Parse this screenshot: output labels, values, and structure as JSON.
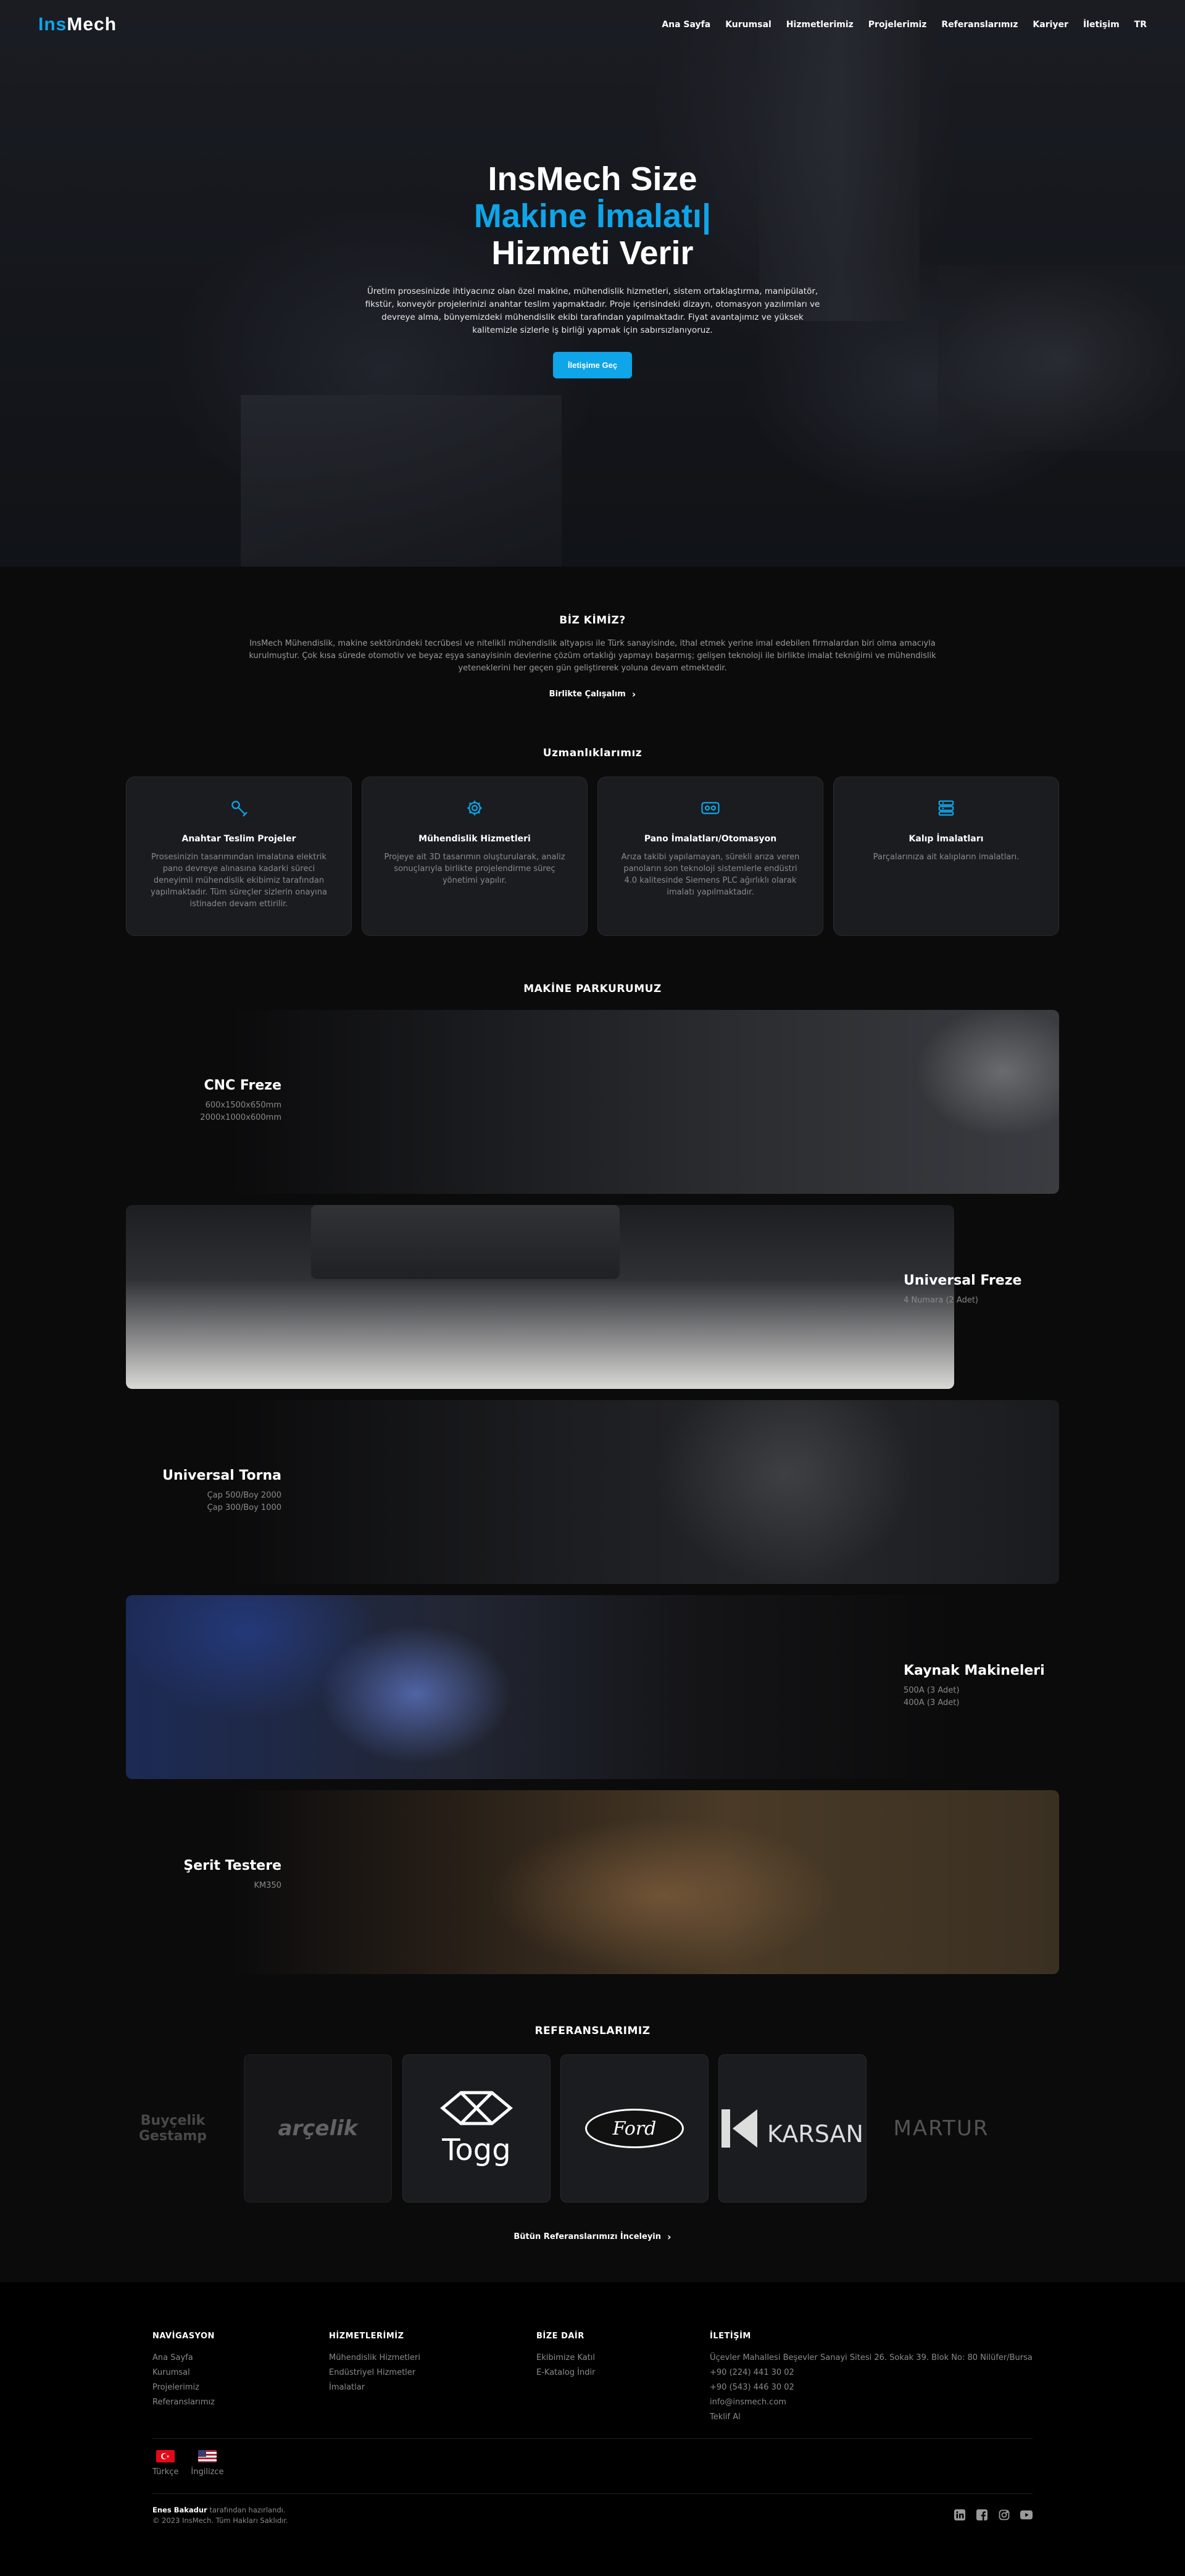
{
  "nav": {
    "logo_prefix": "Ins",
    "logo_suffix": "Mech",
    "items": [
      "Ana Sayfa",
      "Kurumsal",
      "Hizmetlerimiz",
      "Projelerimiz",
      "Referanslarımız",
      "Kariyer",
      "İletişim",
      "TR"
    ]
  },
  "hero": {
    "line1": "InsMech Size",
    "line2": "Makine İmalatı|",
    "line3": "Hizmeti Verir",
    "description": "Üretim prosesinizde ihtiyacınız olan özel makine, mühendislik hizmetleri, sistem ortaklaştırma, manipülatör, fikstür, konveyör projelerinizi anahtar teslim yapmaktadır. Proje içerisindeki dizayn, otomasyon yazılımları ve devreye alma, bünyemizdeki mühendislik ekibi tarafından yapılmaktadır. Fiyat avantajımız ve yüksek kalitemizle sizlerle iş birliği yapmak için sabırsızlanıyoruz.",
    "cta": "İletişime Geç"
  },
  "about": {
    "title": "BİZ KİMİZ?",
    "text": "InsMech Mühendislik, makine sektöründeki tecrübesi ve nitelikli mühendislik altyapısı ile Türk sanayisinde, ithal etmek yerine imal edebilen firmalardan biri olma amacıyla kurulmuştur. Çok kısa sürede otomotiv ve beyaz eşya sanayisinin devlerine çözüm ortaklığı yapmayı başarmış; gelişen teknoloji ile birlikte imalat tekniğimi ve mühendislik yeteneklerini her geçen gün geliştirerek yoluna devam etmektedir.",
    "link": "Birlikte Çalışalım"
  },
  "expertise": {
    "title": "Uzmanlıklarımız",
    "cards": [
      {
        "title": "Anahtar Teslim Projeler",
        "text": "Prosesinizin tasarımından imalatına elektrik pano devreye alınasına kadarki süreci deneyimli mühendislik ekibimiz tarafından yapılmaktadır. Tüm süreçler sizlerin onayına istinaden devam ettirilir.",
        "icon": "wrench-icon"
      },
      {
        "title": "Mühendislik Hizmetleri",
        "text": "Projeye ait 3D tasarımın oluşturularak, analiz sonuçlarıyla birlikte projelendirme süreç yönetimi yapılır.",
        "icon": "gear-icon"
      },
      {
        "title": "Pano İmalatları/Otomasyon",
        "text": "Arıza takibi yapılamayan, sürekli arıza veren panoların son teknoloji sistemlerle endüstri 4.0 kalitesinde Siemens PLC ağırlıklı olarak imalatı yapılmaktadır.",
        "icon": "control-panel-icon"
      },
      {
        "title": "Kalıp İmalatları",
        "text": "Parçalarınıza ait kalıpların imalatları.",
        "icon": "server-stack-icon"
      }
    ]
  },
  "machines": {
    "title": "MAKİNE PARKURUMUZ",
    "items": [
      {
        "name": "CNC Freze",
        "specs": [
          "600x1500x650mm",
          "2000x1000x600mm"
        ]
      },
      {
        "name": "Universal Freze",
        "specs": [
          "4 Numara (2 Adet)"
        ]
      },
      {
        "name": "Universal Torna",
        "specs": [
          "Çap 500/Boy 2000",
          "Çap 300/Boy 1000"
        ]
      },
      {
        "name": "Kaynak Makineleri",
        "specs": [
          "500A (3 Adet)",
          "400A (3 Adet)"
        ]
      },
      {
        "name": "Şerit Testere",
        "specs": [
          "KM350"
        ]
      }
    ]
  },
  "references": {
    "title": "REFERANSLARIMIZ",
    "logos": [
      "Buyçelik Gestamp",
      "arçelik",
      "Togg",
      "Ford",
      "KARSAN",
      "MARTUR"
    ],
    "link": "Bütün Referanslarımızı İnceleyin"
  },
  "footer": {
    "columns": [
      {
        "title": "NAVİGASYON",
        "items": [
          "Ana Sayfa",
          "Kurumsal",
          "Projelerimiz",
          "Referanslarımız"
        ]
      },
      {
        "title": "HİZMETLERİMİZ",
        "items": [
          "Mühendislik Hizmetleri",
          "Endüstriyel Hizmetler",
          "İmalatlar"
        ]
      },
      {
        "title": "BİZE DAİR",
        "items": [
          "Ekibimize Katıl",
          "E-Katalog İndir"
        ]
      },
      {
        "title": "İLETİŞİM",
        "items": [
          "Üçevler Mahallesi Beşevler Sanayi Sitesi 26. Sokak 39. Blok No: 80 Nilüfer/Bursa",
          "+90 (224) 441 30 02",
          "+90 (543) 446 30 02",
          "info@insmech.com",
          "Teklif Al"
        ]
      }
    ],
    "languages": [
      "Türkçe",
      "İngilizce"
    ],
    "credit_author": "Enes Bakadur",
    "credit_suffix": " tarafından hazırlandı.",
    "copyright": "© 2023 InsMech. Tüm Hakları Saklıdır.",
    "socials": [
      "linkedin-icon",
      "facebook-icon",
      "instagram-icon",
      "youtube-icon"
    ]
  },
  "colors": {
    "accent": "#0ea5e9",
    "background": "#0b0b0c",
    "card": "#1b1c1f"
  }
}
